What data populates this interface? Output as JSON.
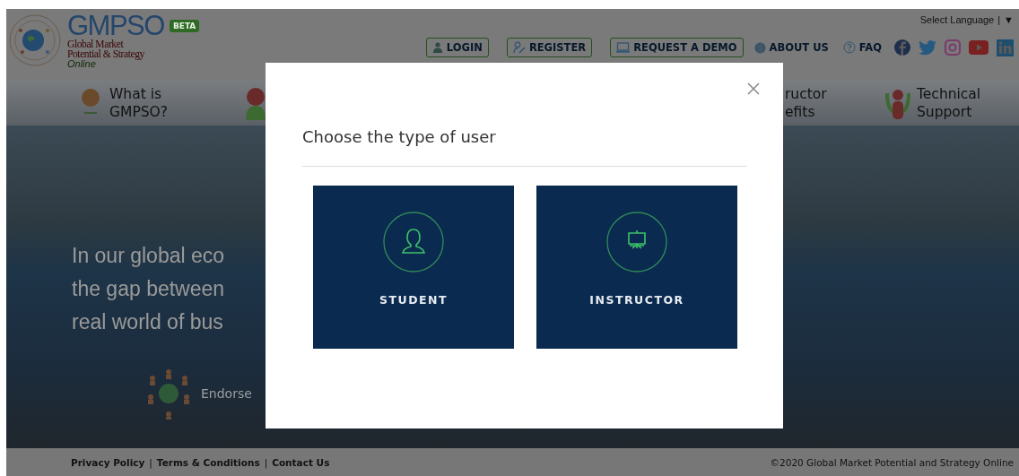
{
  "header": {
    "logo": {
      "title": "GMPSO",
      "badge": "BETA",
      "subtitle_lines": [
        "Global Market",
        "Potential & Strategy"
      ],
      "tagline": "Online"
    },
    "language_selector": {
      "label": "Select Language",
      "separator": "|",
      "arrow": "▼"
    },
    "nav_buttons": [
      {
        "label": "LOGIN",
        "kind": "outlined"
      },
      {
        "label": "REGISTER",
        "kind": "outlined"
      },
      {
        "label": "REQUEST A DEMO",
        "kind": "outlined"
      },
      {
        "label": "ABOUT US",
        "kind": "plain"
      },
      {
        "label": "FAQ",
        "kind": "plain"
      }
    ]
  },
  "menu": [
    {
      "label_lines": [
        "What is",
        "GMPSO?"
      ]
    },
    {
      "label_lines": [
        "ructor",
        "efits"
      ]
    },
    {
      "label_lines": [
        "Technical",
        "Support"
      ]
    }
  ],
  "hero": {
    "heading_lines": [
      "In our global eco",
      "the gap between",
      "real world of bus"
    ],
    "endorsement": "Endorse"
  },
  "footer": {
    "links": [
      "Privacy Policy",
      "Terms & Conditions",
      "Contact Us"
    ],
    "separator": "|",
    "copyright": "©2020 Global Market Potential and Strategy Online"
  },
  "modal": {
    "title": "Choose the type of user",
    "options": [
      {
        "label": "STUDENT"
      },
      {
        "label": "INSTRUCTOR"
      }
    ]
  }
}
